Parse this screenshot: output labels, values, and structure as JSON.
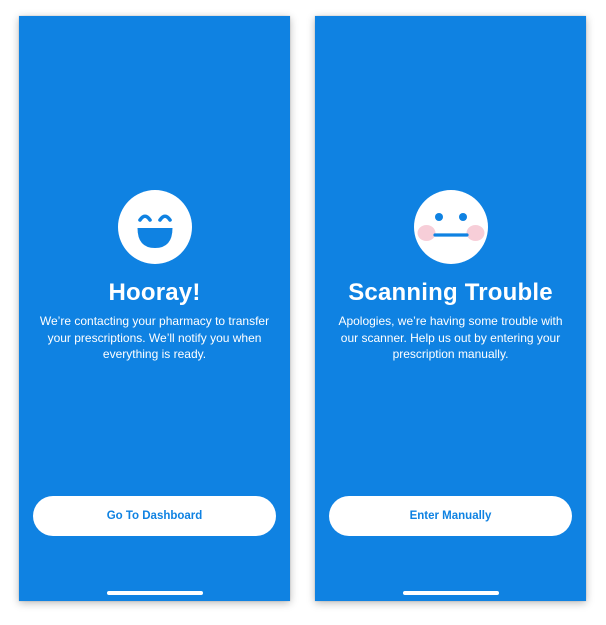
{
  "colors": {
    "background": "#0f82e2",
    "card_text": "#ffffff",
    "button_background": "#ffffff",
    "button_text": "#0f82e2",
    "blush": "#f6c9d4"
  },
  "screens": [
    {
      "icon": "laughing-face-icon",
      "title": "Hooray!",
      "message": "We’re contacting your pharmacy to transfer your prescriptions. We’ll notify you when everything is ready.",
      "button_label": "Go To Dashboard"
    },
    {
      "icon": "neutral-blushing-face-icon",
      "title": "Scanning Trouble",
      "message": "Apologies, we’re having some trouble with our scanner. Help us out by entering your prescription manually.",
      "button_label": "Enter Manually"
    }
  ]
}
